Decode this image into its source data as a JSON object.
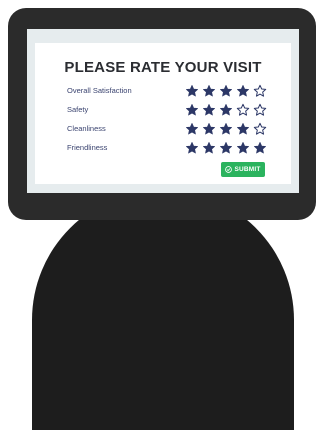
{
  "title": "PLEASE RATE YOUR VISIT",
  "ratings": [
    {
      "label": "Overall Satisfaction",
      "stars": 4,
      "max": 5
    },
    {
      "label": "Safety",
      "stars": 3,
      "max": 5
    },
    {
      "label": "Cleanliness",
      "stars": 4,
      "max": 5
    },
    {
      "label": "Friendliness",
      "stars": 5,
      "max": 5
    }
  ],
  "submit": {
    "label": "SUBMIT",
    "icon": "check-circle-icon"
  },
  "colors": {
    "star": "#2c3766",
    "submit_bg": "#2bb35e",
    "monitor_bezel": "#2b2b2b",
    "person": "#1d1d1d"
  }
}
